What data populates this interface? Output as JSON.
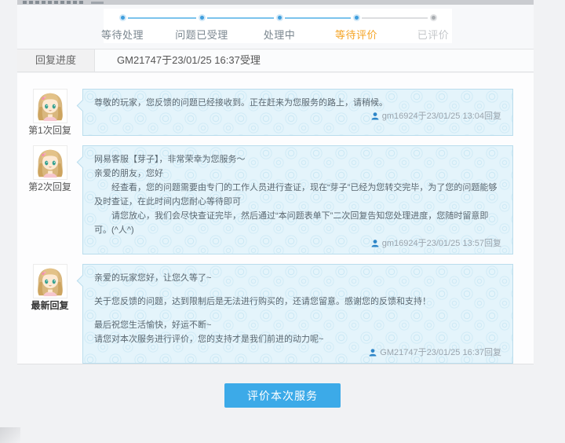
{
  "stepper": {
    "steps": [
      {
        "label": "等待处理",
        "state": "done"
      },
      {
        "label": "问题已受理",
        "state": "done"
      },
      {
        "label": "处理中",
        "state": "done"
      },
      {
        "label": "等待评价",
        "state": "current"
      },
      {
        "label": "已评价",
        "state": "pending"
      }
    ]
  },
  "progress_row": {
    "label": "回复进度",
    "value": "GM21747于23/01/25 16:37受理"
  },
  "replies": [
    {
      "label": "第1次回复",
      "latest": false,
      "lines": [
        "尊敬的玩家，您反馈的问题已经接收到。正在赶来为您服务的路上，请稍候。"
      ],
      "timestamp": "gm16924于23/01/25 13:04回复"
    },
    {
      "label": "第2次回复",
      "latest": false,
      "lines": [
        "网易客服【芽子】，非常荣幸为您服务～",
        "亲爱的朋友，您好",
        "　　经查看，您的问题需要由专门的工作人员进行查证，现在“芽子”已经为您转交完毕，为了您的问题能够及时查证，在此时间内您耐心等待即可",
        "　　请您放心，我们会尽快查证完毕，然后通过“本问题表单下”二次回复告知您处理进度，您随时留意即可。(^人^)"
      ],
      "timestamp": "gm16924于23/01/25 13:57回复"
    },
    {
      "label": "最新回复",
      "latest": true,
      "lines": [
        "亲爱的玩家您好，让您久等了~",
        "",
        "关于您反馈的问题，达到限制后是无法进行购买的，还请您留意。感谢您的反馈和支持！",
        "",
        "最后祝您生活愉快，好运不断~",
        "请您对本次服务进行评价，您的支持才是我们前进的动力呢~"
      ],
      "timestamp": "GM21747于23/01/25 16:37回复"
    }
  ],
  "footer": {
    "evaluate_button_label": "评价本次服务"
  },
  "colors": {
    "accent_blue": "#3caae8",
    "step_active_dot": "#3f9edd",
    "step_current_label": "#f5a425",
    "bubble_bg": "#e4f4fb",
    "bubble_border": "#badded",
    "timestamp_icon": "#2e86c8"
  }
}
